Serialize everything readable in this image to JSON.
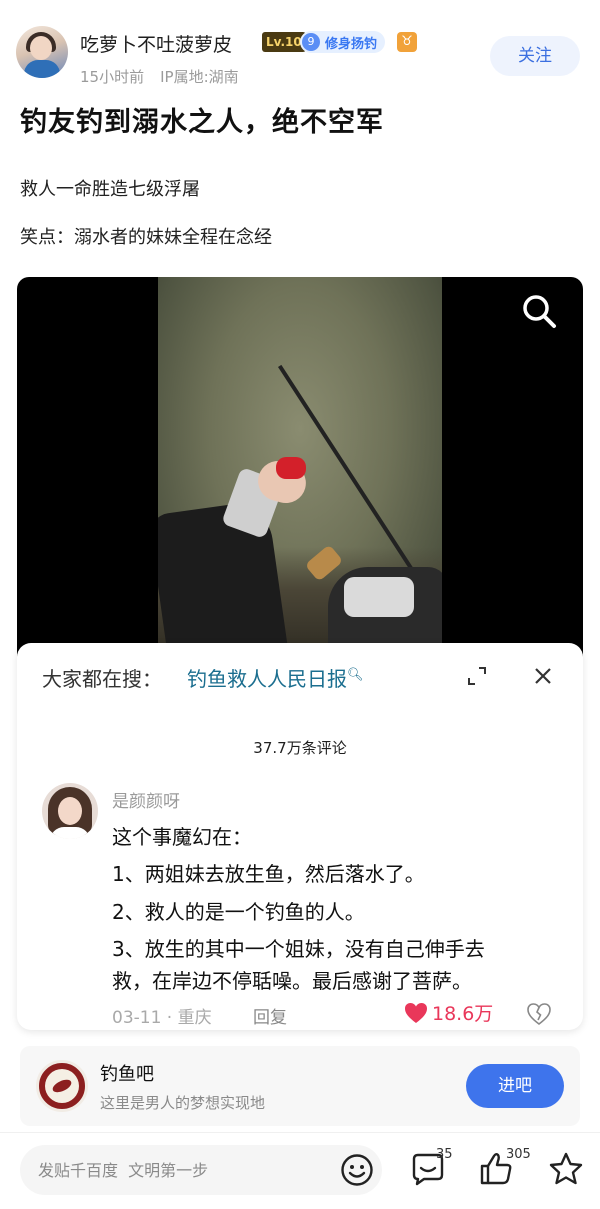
{
  "author": {
    "name": "吃萝卜不吐菠萝皮",
    "level": "Lv.10",
    "tag_number": "9",
    "tag_label": "修身扬钓",
    "zodiac_symbol": "♉",
    "time": "15小时前",
    "location": "IP属地:湖南",
    "follow_label": "关注"
  },
  "post": {
    "title": "钓友钓到溺水之人，绝不空军",
    "lines": [
      "救人一命胜造七级浮屠",
      "笑点：溺水者的妹妹全程在念经"
    ]
  },
  "popup": {
    "hot_label": "大家都在搜：",
    "hot_link": "钓鱼救人人民日报",
    "comment_count": "37.7万条评论",
    "comment": {
      "user": "是颜颜呀",
      "lines": [
        "这个事魔幻在：",
        "1、两姐妹去放生鱼，然后落水了。",
        "2、救人的是一个钓鱼的人。",
        "3、放生的其中一个姐妹，没有自己伸手去",
        "救，在岸边不停聒噪。最后感谢了菩萨。"
      ],
      "date": "03-11",
      "place": "重庆",
      "reply_label": "回复",
      "likes": "18.6万"
    }
  },
  "forum": {
    "name": "钓鱼吧",
    "desc": "这里是男人的梦想实现地",
    "join_label": "进吧"
  },
  "bottom_bar": {
    "input_placeholder": "发贴千百度  文明第一步",
    "comments_count": "35",
    "likes_count": "305"
  },
  "colors": {
    "accent": "#3e74ec",
    "like_red": "#e9375a",
    "link_teal": "#1b6e8f"
  },
  "icons": [
    "search-icon",
    "expand-icon",
    "close-icon",
    "heart-icon",
    "broken-heart-icon",
    "emoji-icon",
    "comment-icon",
    "thumb-up-icon",
    "star-icon"
  ]
}
